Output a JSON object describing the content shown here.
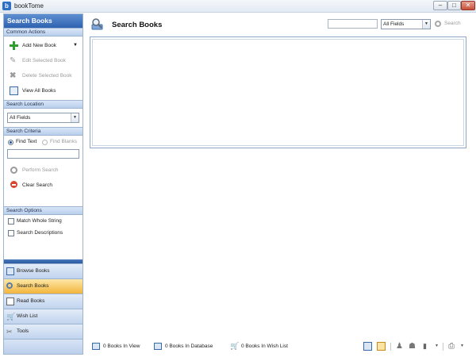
{
  "window": {
    "title": "bookTome",
    "app_icon": "book-icon"
  },
  "sidebar": {
    "title": "Search Books",
    "common_actions": {
      "header": "Common Actions",
      "items": [
        {
          "label": "Add New Book",
          "icon": "plus-icon",
          "enabled": true
        },
        {
          "label": "Edit Selected Book",
          "icon": "pencil-icon",
          "enabled": false
        },
        {
          "label": "Delete Selected Book",
          "icon": "delete-icon",
          "enabled": false
        },
        {
          "label": "View All Books",
          "icon": "view-icon",
          "enabled": true
        }
      ]
    },
    "search_location": {
      "header": "Search Location",
      "selected": "All Fields"
    },
    "search_criteria": {
      "header": "Search Criteria",
      "find_text": "Find Text",
      "find_blanks": "Find Blanks",
      "search_value": "",
      "perform_search": "Perform Search",
      "clear_search": "Clear Search"
    },
    "search_options": {
      "header": "Search Options",
      "match_whole": "Match Whole String",
      "search_descriptions": "Search Descriptions"
    }
  },
  "nav": [
    {
      "label": "Browse Books",
      "icon": "browse-icon",
      "active": false
    },
    {
      "label": "Search Books",
      "icon": "search-icon",
      "active": true
    },
    {
      "label": "Read Books",
      "icon": "read-icon",
      "active": false
    },
    {
      "label": "Wish List",
      "icon": "wish-list-icon",
      "active": false
    },
    {
      "label": "Tools",
      "icon": "tools-icon",
      "active": false
    }
  ],
  "main": {
    "title": "Search Books",
    "search_value": "",
    "field_selected": "All Fields",
    "search_button": "Search"
  },
  "status": {
    "in_view": "0 Books In View",
    "in_database": "0 Books In Database",
    "in_wish_list": "0 Books In Wish List"
  },
  "colors": {
    "accent": "#2e62b0",
    "active_nav": "#f3b53c",
    "pane_bg": "#c0d3ee"
  }
}
